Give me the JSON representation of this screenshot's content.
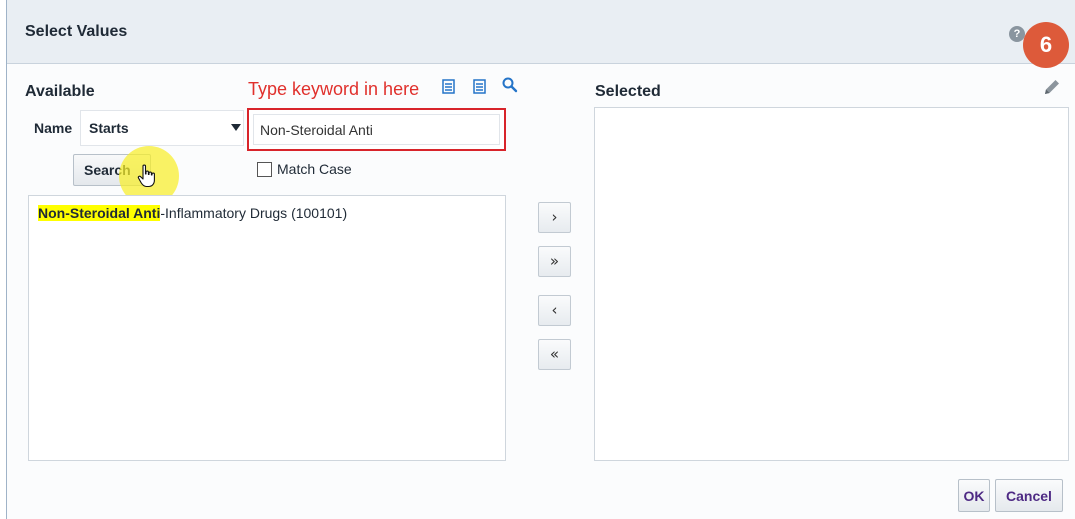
{
  "dialog": {
    "title": "Select Values",
    "help_glyph": "?",
    "step_badge": "6"
  },
  "annotation": {
    "text": "Type keyword in here",
    "color": "#e0302c"
  },
  "available": {
    "label": "Available",
    "name_label": "Name",
    "operator_selected": "Starts",
    "keyword_value": "Non-Steroidal Anti",
    "search_label": "Search",
    "match_case_label": "Match Case",
    "match_case_checked": false,
    "items": [
      {
        "highlight": "Non-Steroidal Anti",
        "rest": "-Inflammatory Drugs (100101)"
      }
    ]
  },
  "shuttle": {
    "move": "›",
    "move_all": "»",
    "remove": "‹",
    "remove_all": "«"
  },
  "selected": {
    "label": "Selected",
    "items": []
  },
  "footer": {
    "ok_label": "OK",
    "cancel_label": "Cancel"
  },
  "icons": [
    "help-icon",
    "list-view-icon",
    "list-view-alt-icon",
    "search-icon",
    "edit-pencil-icon",
    "hand-cursor-icon"
  ],
  "colors": {
    "accent_blue": "#2474c8",
    "badge_orange": "#dd5a3a",
    "highlight_yellow": "#ffff00",
    "annotation_red": "#d8242a",
    "button_text_purple": "#4e2a84"
  }
}
